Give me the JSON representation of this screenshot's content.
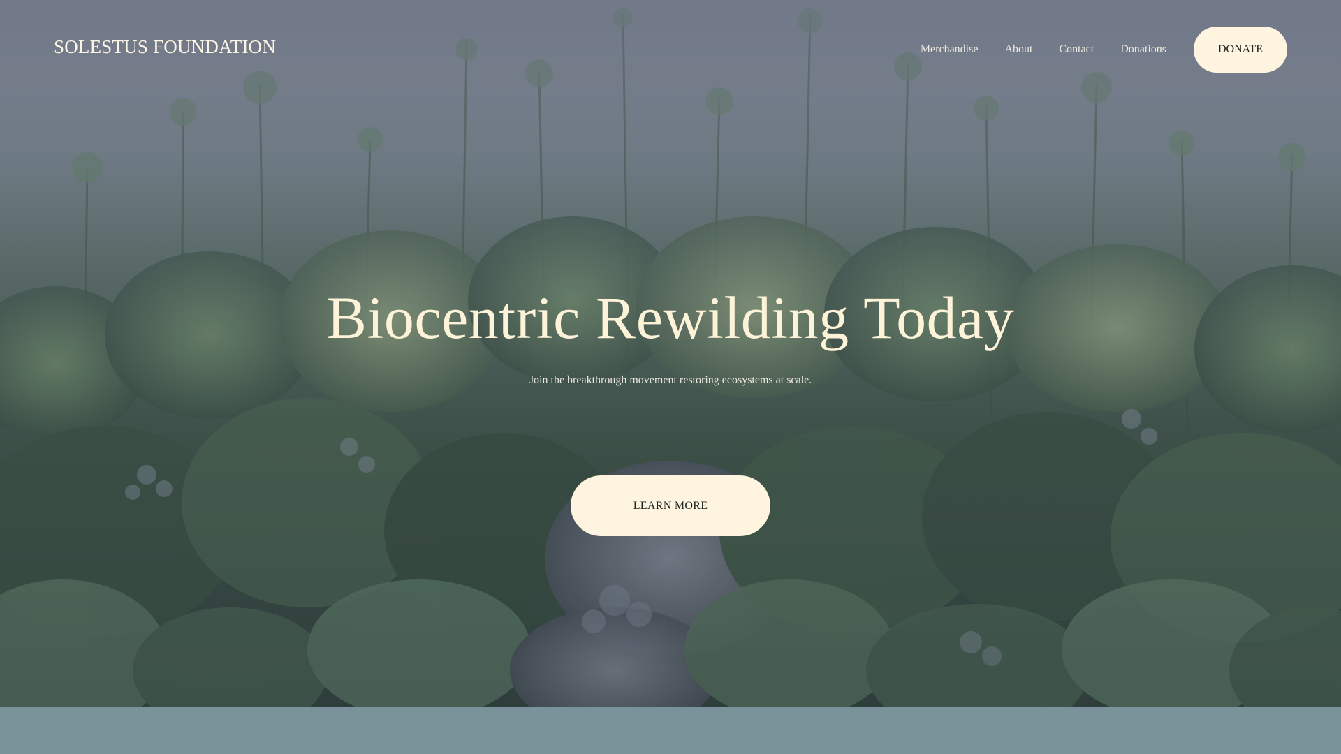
{
  "header": {
    "logo": "SOLESTUS FOUNDATION",
    "nav": [
      {
        "label": "Merchandise"
      },
      {
        "label": "About"
      },
      {
        "label": "Contact"
      },
      {
        "label": "Donations"
      }
    ],
    "donate_label": "DONATE"
  },
  "hero": {
    "title": "Biocentric Rewilding Today",
    "subtitle": "Join the breakthrough movement restoring ecosystems at scale.",
    "cta_label": "LEARN MORE"
  },
  "colors": {
    "accent_cream": "#fef4df",
    "title_cream": "#fdf3d8",
    "band": "#7a939a"
  }
}
